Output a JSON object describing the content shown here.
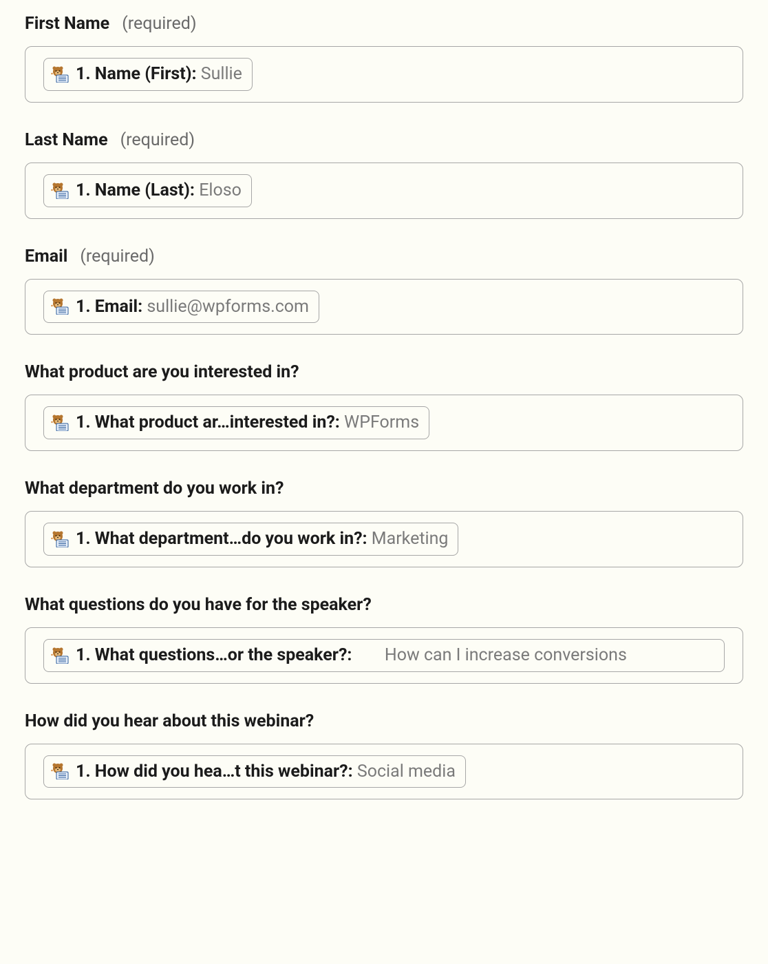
{
  "required_text": "(required)",
  "fields": [
    {
      "label": "First Name",
      "required": true,
      "tag_key": "1. Name (First): ",
      "tag_value": "Sullie",
      "wide": false
    },
    {
      "label": "Last Name",
      "required": true,
      "tag_key": "1. Name (Last): ",
      "tag_value": "Eloso",
      "wide": false
    },
    {
      "label": "Email",
      "required": true,
      "tag_key": "1. Email: ",
      "tag_value": "sullie@wpforms.com",
      "wide": false
    },
    {
      "label": "What product are you interested in?",
      "required": false,
      "tag_key": "1. What product ar…interested in?: ",
      "tag_value": "WPForms",
      "wide": false
    },
    {
      "label": "What department do you work in?",
      "required": false,
      "tag_key": "1. What department…do you work in?: ",
      "tag_value": "Marketing",
      "wide": false
    },
    {
      "label": "What questions do you have for the speaker?",
      "required": false,
      "tag_key": "1. What questions…or the speaker?:",
      "tag_value": "How can I increase conversions",
      "wide": true
    },
    {
      "label": "How did you hear about this webinar?",
      "required": false,
      "tag_key": "1. How did you hea…t this webinar?: ",
      "tag_value": "Social media",
      "wide": false
    }
  ]
}
